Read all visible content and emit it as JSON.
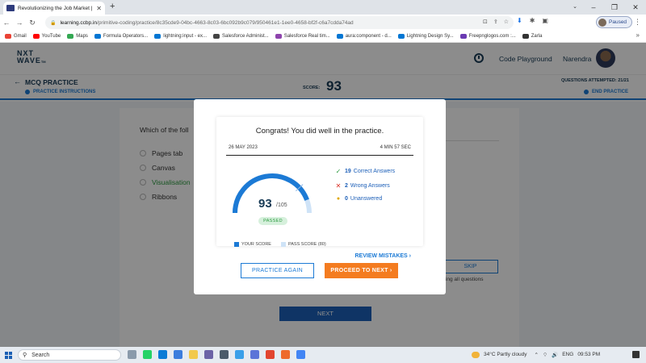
{
  "browser": {
    "tab_title": "Revolutionizing the Job Market |",
    "tab_close": "✕",
    "new_tab": "+",
    "url_host": "learning.ccbp.in",
    "url_path": "/primitive-coding/practice/8c35cde9-04bc-4663-8c03-6bc092b9c079/950461e1-1ee0-4658-bf2f-c6a7cdda74ad",
    "profile_label": "Paused",
    "bookmarks": [
      {
        "label": "Gmail",
        "color": "#ea4335"
      },
      {
        "label": "YouTube",
        "color": "#ff0000"
      },
      {
        "label": "Maps",
        "color": "#34a853"
      },
      {
        "label": "Formula Operators...",
        "color": "#0176d3"
      },
      {
        "label": "lightning:input - ex...",
        "color": "#0176d3"
      },
      {
        "label": "Salesforce Administ...",
        "color": "#444444"
      },
      {
        "label": "Salesforce Real tim...",
        "color": "#8e44ad"
      },
      {
        "label": "aura:component - d...",
        "color": "#0176d3"
      },
      {
        "label": "Lightning Design Sy...",
        "color": "#0176d3"
      },
      {
        "label": "Freepnglogos.com :...",
        "color": "#6a3ab2"
      },
      {
        "label": "Zarla",
        "color": "#333333"
      }
    ]
  },
  "header": {
    "logo_line1": "NXT",
    "logo_line2": "WAVE",
    "logo_tm": "TM",
    "code_playground": "Code Playground",
    "user_name": "Narendra"
  },
  "subheader": {
    "title": "MCQ PRACTICE",
    "instructions": "PRACTICE INSTRUCTIONS",
    "score_label": "SCORE:",
    "score_value": "93",
    "attempted": "QUESTIONS ATTEMPTED: 21/21",
    "end_practice": "END PRACTICE"
  },
  "question": {
    "text": "Which of the foll",
    "options": [
      "Pages tab",
      "Canvas",
      "Visualisation",
      "Ribbons"
    ],
    "selected_index": 2,
    "skip_label": "SKIP",
    "finish_note": "nishing all questions",
    "next_label": "NEXT"
  },
  "modal": {
    "heading": "Congrats! You did well in the practice.",
    "date": "26 MAY 2023",
    "duration": "4 MIN 57 SEC",
    "score": "93",
    "total": "/105",
    "score_fraction": 0.886,
    "pass_fraction": 0.762,
    "status": "PASSED",
    "correct_count": "19",
    "correct_label": "Correct Answers",
    "wrong_count": "2",
    "wrong_label": "Wrong Answers",
    "unanswered_count": "0",
    "unanswered_label": "Unanswered",
    "legend_your_score": "YOUR SCORE",
    "legend_pass_score": "PASS SCORE (80)",
    "review_label": "REVIEW MISTAKES",
    "practice_again": "PRACTICE AGAIN",
    "proceed_next": "PROCEED TO NEXT",
    "colors": {
      "your_score": "#1c7ad5",
      "pass_score": "#cfe3f7",
      "correct": "#2b9a3f",
      "wrong": "#d93025",
      "unanswered": "#e0a800",
      "proceed": "#f47c20"
    }
  },
  "taskbar": {
    "search_label": "Search",
    "weather": "34°C  Partly cloudy",
    "language": "ENG",
    "time": "09:53 PM"
  }
}
